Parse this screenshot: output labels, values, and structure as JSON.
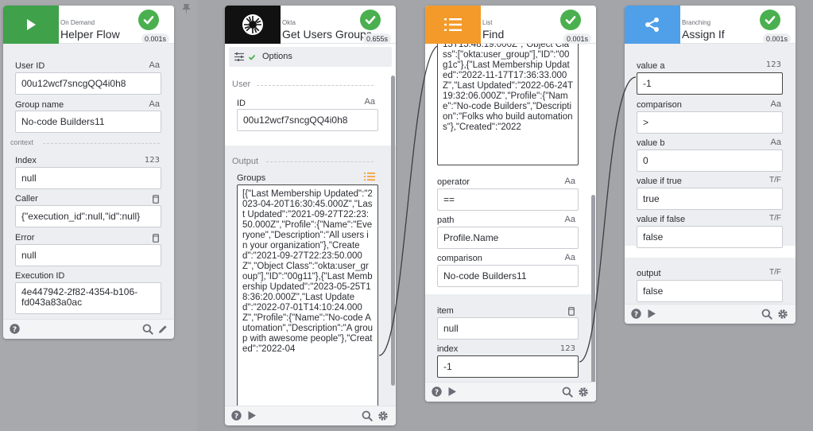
{
  "helper_flow": {
    "category": "On Demand",
    "title": "Helper Flow",
    "timing": "0.001s",
    "fields": [
      {
        "label": "User ID",
        "type": "Aa",
        "value": "00u12wcf7sncgQQ4i0h8"
      },
      {
        "label": "Group name",
        "type": "Aa",
        "value": "No-code Builders11"
      }
    ],
    "context_label": "context",
    "context_fields": [
      {
        "label": "Index",
        "type": "123",
        "value": "null"
      },
      {
        "label": "Caller",
        "type": "object",
        "value": "{\"execution_id\":null,\"id\":null}"
      },
      {
        "label": "Error",
        "type": "object",
        "value": "null"
      },
      {
        "label": "Execution ID",
        "type": "",
        "value": "4e447942-2f82-4354-b106-fd043a83a0ac"
      }
    ]
  },
  "okta_card": {
    "category": "Okta",
    "title": "Get Users Groups",
    "timing": "0.655s",
    "options_label": "Options",
    "user_section": "User",
    "id_label": "ID",
    "id_type": "Aa",
    "id_value": "00u12wcf7sncgQQ4i0h8",
    "output_section": "Output",
    "groups_label": "Groups",
    "groups_value": "[{\"Last Membership Updated\":\"2023-04-20T16:30:45.000Z\",\"Last Updated\":\"2021-09-27T22:23:50.000Z\",\"Profile\":{\"Name\":\"Everyone\",\"Description\":\"All users in your organization\"},\"Created\":\"2021-09-27T22:23:50.000Z\",\"Object Class\":\"okta:user_group\"],\"ID\":\"00g11\"},{\"Last Membership Updated\":\"2023-05-25T18:36:20.000Z\",\"Last Updated\":\"2022-07-01T14:10:24.000Z\",\"Profile\":{\"Name\":\"No-code Automation\",\"Description\":\"A group with awesome people\"},\"Created\":\"2022-04"
  },
  "list_card": {
    "category": "List",
    "title": "Find",
    "timing": "0.001s",
    "top_text": "15T15:48:19.000Z\",\"Object Class\":[\"okta:user_group\"],\"ID\":\"00g1c\"},{\"Last Membership Updated\":\"2022-11-17T17:36:33.000Z\",\"Last Updated\":\"2022-06-24T19:32:06.000Z\",\"Profile\":{\"Name\":\"No-code Builders\",\"Description\":\"Folks who build automations\"},\"Created\":\"2022",
    "fields": [
      {
        "label": "operator",
        "type": "Aa",
        "value": "=="
      },
      {
        "label": "path",
        "type": "Aa",
        "value": "Profile.Name"
      },
      {
        "label": "comparison",
        "type": "Aa",
        "value": "No-code Builders11"
      }
    ],
    "item_label": "item",
    "item_value": "null",
    "index_label": "index",
    "index_type": "123",
    "index_value": "-1"
  },
  "branch_card": {
    "category": "Branching",
    "title": "Assign If",
    "timing": "0.001s",
    "fields": [
      {
        "label": "value a",
        "type": "123",
        "value": "-1"
      },
      {
        "label": "comparison",
        "type": "Aa",
        "value": ">"
      },
      {
        "label": "value b",
        "type": "Aa",
        "value": "0"
      },
      {
        "label": "value if true",
        "type": "T/F",
        "value": "true"
      },
      {
        "label": "value if false",
        "type": "T/F",
        "value": "false"
      }
    ],
    "output_label": "output",
    "output_type": "T/F",
    "output_value": "false"
  }
}
